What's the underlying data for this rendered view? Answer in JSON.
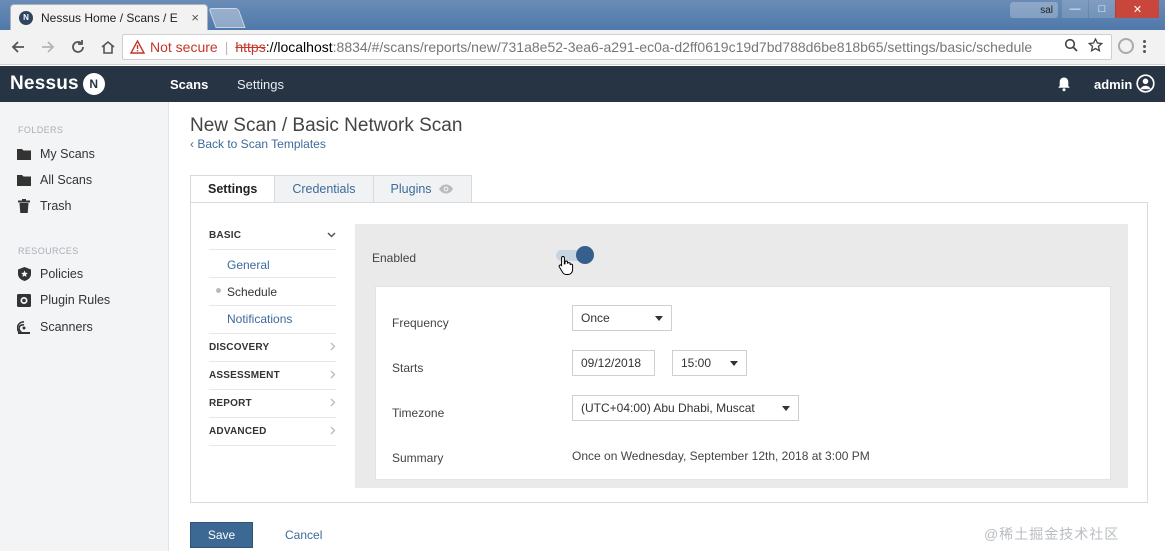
{
  "browser": {
    "tab_title": "Nessus Home / Scans / E",
    "tab_favicon": "N",
    "tab_close": "×",
    "user_chip": "sal",
    "security_label": "Not secure",
    "url_proto": "https",
    "url_host": "://localhost",
    "url_path": ":8834/#/scans/reports/new/731a8e52-3ea6-a291-ec0a-d2ff0619c19d7bd788d6be818b65/settings/basic/schedule"
  },
  "header": {
    "logo_text": "Nessus",
    "logo_badge": "N",
    "nav_scans": "Scans",
    "nav_settings": "Settings",
    "user_name": "admin"
  },
  "sidebar": {
    "folders_title": "FOLDERS",
    "resources_title": "RESOURCES",
    "folders": [
      {
        "label": "My Scans",
        "icon": "folder-icon"
      },
      {
        "label": "All Scans",
        "icon": "folder-icon"
      },
      {
        "label": "Trash",
        "icon": "trash-icon"
      }
    ],
    "resources": [
      {
        "label": "Policies",
        "icon": "shield-icon"
      },
      {
        "label": "Plugin Rules",
        "icon": "plugin-rules-icon"
      },
      {
        "label": "Scanners",
        "icon": "scanners-icon"
      }
    ]
  },
  "page": {
    "title": "New Scan / Basic Network Scan",
    "back_link": "‹ Back to Scan Templates",
    "tabs": [
      "Settings",
      "Credentials",
      "Plugins"
    ],
    "active_tab": "Settings"
  },
  "leftnav": {
    "basic": "BASIC",
    "basic_items": [
      "General",
      "Schedule",
      "Notifications"
    ],
    "current_item": "Schedule",
    "discovery": "DISCOVERY",
    "assessment": "ASSESSMENT",
    "report": "REPORT",
    "advanced": "ADVANCED"
  },
  "schedule": {
    "enabled_label": "Enabled",
    "enabled": true,
    "frequency_label": "Frequency",
    "frequency_value": "Once",
    "starts_label": "Starts",
    "start_date": "09/12/2018",
    "start_time": "15:00",
    "timezone_label": "Timezone",
    "timezone_value": "(UTC+04:00) Abu Dhabi, Muscat",
    "summary_label": "Summary",
    "summary_value": "Once on Wednesday, September 12th, 2018 at 3:00 PM"
  },
  "actions": {
    "save": "Save",
    "cancel": "Cancel"
  },
  "watermark": "@稀土掘金技术社区",
  "colors": {
    "header_bg": "#263444",
    "accent": "#3c6894",
    "link": "#3d6b9b",
    "not_secure": "#c5372c"
  }
}
